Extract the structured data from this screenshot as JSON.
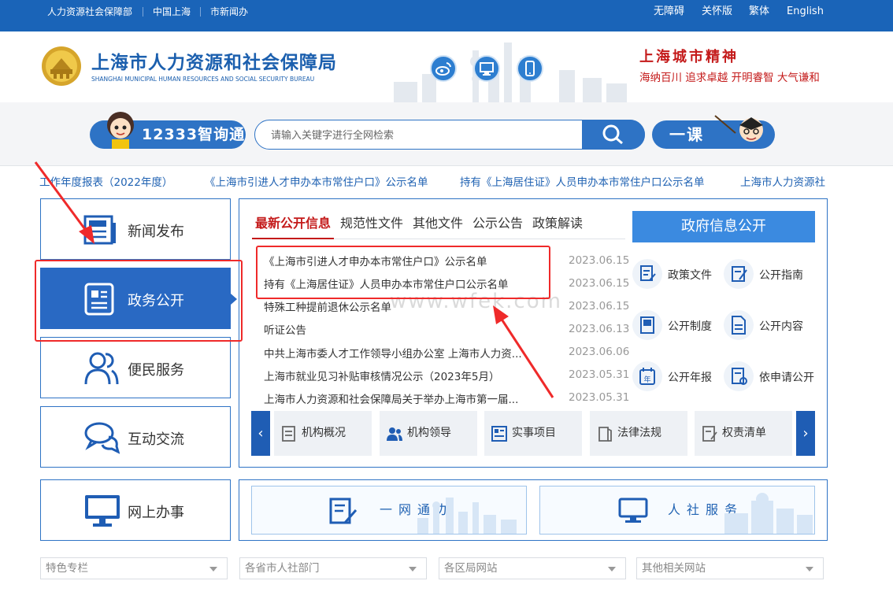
{
  "topbar": {
    "links": [
      "人力资源社会保障部",
      "中国上海",
      "市新闻办"
    ],
    "right": [
      "无障碍",
      "关怀版",
      "繁体",
      "English"
    ]
  },
  "header": {
    "title": "上海市人力资源和社会保障局",
    "subtitle": "SHANGHAI MUNICIPAL HUMAN RESOURCES AND SOCIAL SECURITY BUREAU",
    "social_icons": [
      "weibo-icon",
      "monitor-icon",
      "mobile-icon"
    ],
    "spirit_title": "上海城市精神",
    "spirit_values": "海纳百川  追求卓越  开明睿智  大气谦和"
  },
  "search": {
    "assistant_label": "12333智询通",
    "placeholder": "请输入关键字进行全网检索",
    "course_label": "一课"
  },
  "ticker": [
    "工作年度报表（2022年度）",
    "《上海市引进人才申办本市常住户口》公示名单",
    "持有《上海居住证》人员申办本市常住户口公示名单",
    "上海市人力资源社"
  ],
  "left_nav": [
    {
      "label": "新闻发布",
      "icon": "newspaper-icon"
    },
    {
      "label": "政务公开",
      "icon": "document-icon"
    },
    {
      "label": "便民服务",
      "icon": "people-icon"
    },
    {
      "label": "互动交流",
      "icon": "chat-bubbles-icon"
    },
    {
      "label": "网上办事",
      "icon": "computer-monitor-icon"
    }
  ],
  "tabs": [
    "最新公开信息",
    "规范性文件",
    "其他文件",
    "公示公告",
    "政策解读"
  ],
  "news": [
    {
      "title": "《上海市引进人才申办本市常住户口》公示名单",
      "date": "2023.06.15"
    },
    {
      "title": "持有《上海居住证》人员申办本市常住户口公示名单",
      "date": "2023.06.15"
    },
    {
      "title": "特殊工种提前退休公示名单",
      "date": "2023.06.15"
    },
    {
      "title": "听证公告",
      "date": "2023.06.13"
    },
    {
      "title": "中共上海市委人才工作领导小组办公室 上海市人力资...",
      "date": "2023.06.06"
    },
    {
      "title": "上海市就业见习补贴审核情况公示（2023年5月）",
      "date": "2023.05.31"
    },
    {
      "title": "上海市人力资源和社会保障局关于举办上海市第一届...",
      "date": "2023.05.31"
    }
  ],
  "gov_info": {
    "button": "政府信息公开",
    "items": [
      "政策文件",
      "公开指南",
      "公开制度",
      "公开内容",
      "公开年报",
      "依申请公开"
    ]
  },
  "quick_links": [
    "机构概况",
    "机构领导",
    "实事项目",
    "法律法规",
    "权责清单"
  ],
  "service_banners": [
    "一网通办",
    "人社服务"
  ],
  "dropdowns": [
    "特色专栏",
    "各省市人社部门",
    "各区局网站",
    "其他相关网站"
  ],
  "watermark": "www.wfek.com",
  "colors": {
    "brand_blue": "#2969c3",
    "top_bar": "#1a64b8",
    "accent_red": "#c41a1a",
    "annotation_red": "#ef2a2a"
  }
}
